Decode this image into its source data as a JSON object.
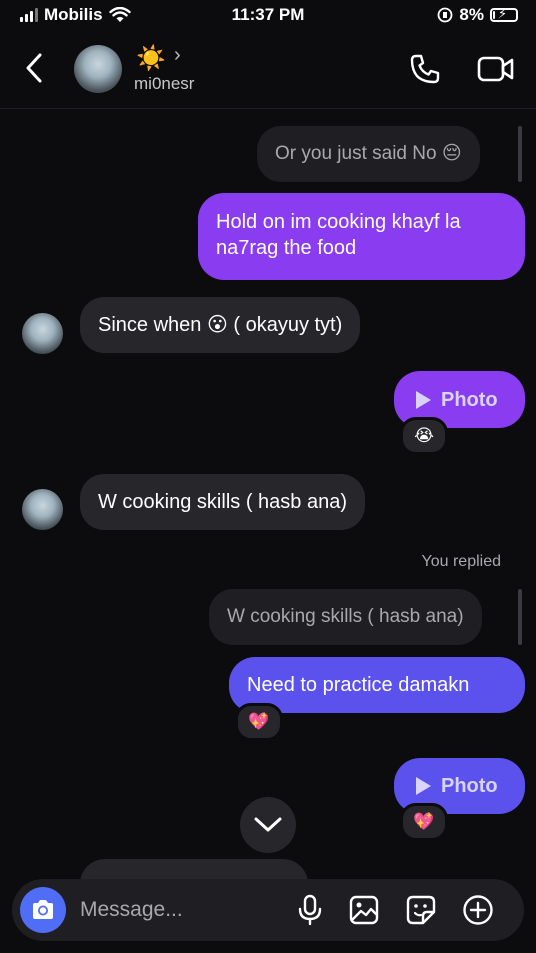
{
  "status_bar": {
    "carrier": "Mobilis",
    "time": "11:37 PM",
    "battery": "8%",
    "battery_level": 0.08
  },
  "header": {
    "name": "mi0nesr",
    "status_emoji": "☀️",
    "chevron": "›"
  },
  "icons": {
    "back": "chevron-left-icon",
    "call": "phone-icon",
    "video": "video-camera-icon",
    "scroll_down": "chevron-down-icon",
    "camera": "camera-icon",
    "mic": "microphone-icon",
    "gallery": "image-icon",
    "sticker": "sticker-icon",
    "more": "plus-circle-icon"
  },
  "messages": {
    "reply_1": "Or you just said No 😔",
    "sent_1": "Hold on im cooking khayf la na7rag the food",
    "recv_1": "Since when 😮 ( okayuy tyt)",
    "photo_1": "Photo",
    "photo_1_reaction": "😭",
    "recv_2": "W cooking skills ( hasb ana)",
    "you_replied": "You replied",
    "reply_2": "W cooking skills ( hasb ana)",
    "sent_2": "Need to practice damakn",
    "sent_2_reaction": "💖",
    "photo_2": "Photo",
    "photo_2_reaction": "💖"
  },
  "composer": {
    "placeholder": "Message..."
  },
  "colors": {
    "background": "#0c0c0f",
    "received": "#26262b",
    "sent_purple": "#8a3cf0",
    "sent_indigo": "#5b52ee",
    "camera": "#4f6df5"
  }
}
